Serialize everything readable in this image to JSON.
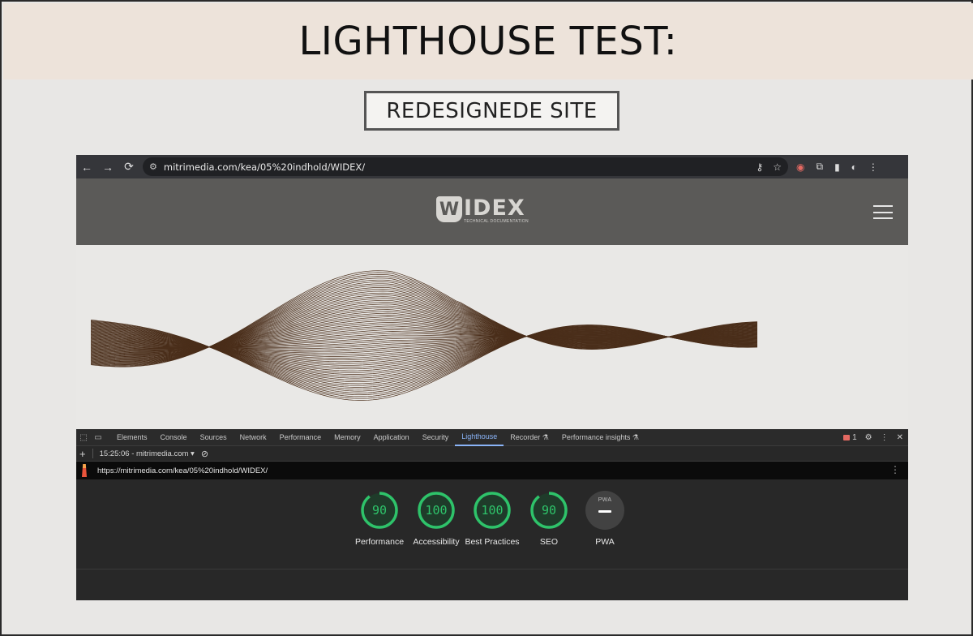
{
  "slide": {
    "title": "LIGHTHOUSE TEST:",
    "subtitle": "REDESIGNEDE SITE"
  },
  "browser": {
    "url": "mitrimedia.com/kea/05%20indhold/WIDEX/",
    "back_icon": "←",
    "forward_icon": "→",
    "reload_icon": "⟳"
  },
  "site": {
    "logo_word": "IDEX",
    "logo_mark": "W",
    "logo_sub": "TECHNICAL DOCUMENTATION"
  },
  "devtools": {
    "tabs": [
      "Elements",
      "Console",
      "Sources",
      "Network",
      "Performance",
      "Memory",
      "Application",
      "Security",
      "Lighthouse",
      "Recorder ⚗",
      "Performance insights ⚗"
    ],
    "active_tab": "Lighthouse",
    "error_count": "1",
    "report_label": "15:25:06 - mitrimedia.com ▾",
    "audited_url": "https://mitrimedia.com/kea/05%20indhold/WIDEX/",
    "score_color": "#2ec36a",
    "scores": [
      {
        "label": "Performance",
        "value": "90"
      },
      {
        "label": "Accessibility",
        "value": "100"
      },
      {
        "label": "Best Practices",
        "value": "100"
      },
      {
        "label": "SEO",
        "value": "90"
      }
    ],
    "pwa": {
      "label": "PWA",
      "badge": "PWA"
    }
  }
}
